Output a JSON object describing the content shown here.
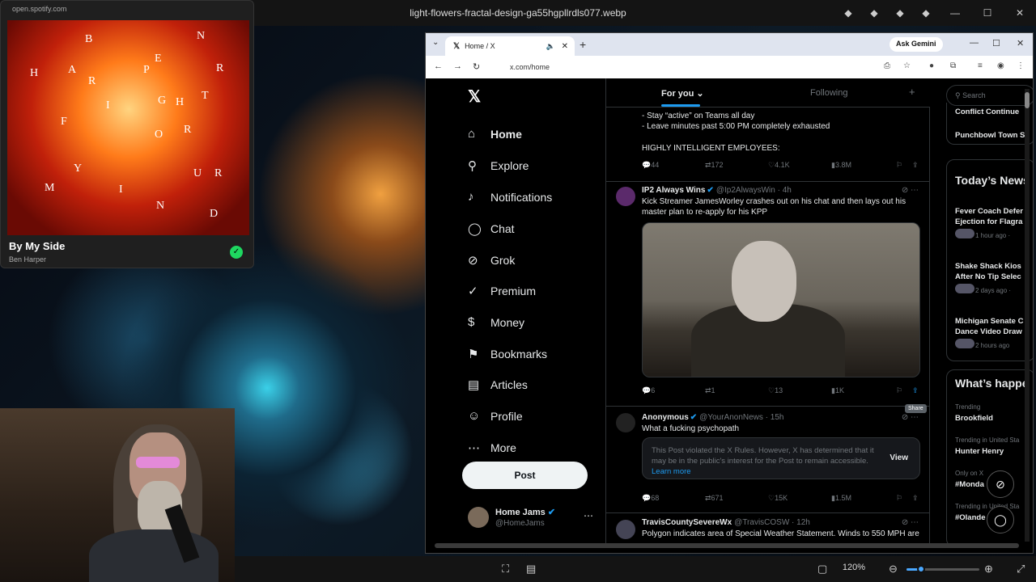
{
  "viewer": {
    "title": "light-flowers-fractal-design-ga55hgpllrdls077.webp",
    "zoom": "120%",
    "zoom_level": 0.2
  },
  "spotify": {
    "url": "open.spotify.com",
    "song": "By My Side",
    "artist": "Ben Harper",
    "letters": [
      "B",
      "N",
      "E",
      "H",
      "A",
      "R",
      "P",
      "R",
      "T",
      "G",
      "H",
      "I",
      "F",
      "R",
      "O",
      "Y",
      "U",
      "R",
      "M",
      "I",
      "N",
      "D"
    ]
  },
  "browser": {
    "tab_title": "Home / X",
    "ask_gemini": "Ask Gemini",
    "url": "x.com/home"
  },
  "sidebar": {
    "items": [
      {
        "label": "Home",
        "icon": "⌂"
      },
      {
        "label": "Explore",
        "icon": "⚲"
      },
      {
        "label": "Notifications",
        "icon": "♪"
      },
      {
        "label": "Chat",
        "icon": "◯"
      },
      {
        "label": "Grok",
        "icon": "⊘"
      },
      {
        "label": "Premium",
        "icon": "✓"
      },
      {
        "label": "Money",
        "icon": "$"
      },
      {
        "label": "Bookmarks",
        "icon": "⚑"
      },
      {
        "label": "Articles",
        "icon": "▤"
      },
      {
        "label": "Profile",
        "icon": "☺"
      },
      {
        "label": "More",
        "icon": "⋯"
      }
    ],
    "post_button": "Post",
    "account_name": "Home Jams",
    "account_handle": "@HomeJams"
  },
  "feed": {
    "tabs": [
      "For you",
      "Following"
    ],
    "post0": {
      "lines": [
        "- Stay “active” on Teams all day",
        "- Leave minutes past 5:00 PM completely exhausted",
        "HIGHLY INTELLIGENT EMPLOYEES:"
      ],
      "replies": "44",
      "reposts": "172",
      "likes": "4.1K",
      "views": "3.8M"
    },
    "post1": {
      "name": "IP2 Always Wins",
      "meta": "@Ip2AlwaysWin · 4h",
      "text1": "Kick Streamer JamesWorley crashes out on his chat and then lays out his",
      "text2": "master plan to re-apply for his KPP",
      "replies": "6",
      "reposts": "1",
      "likes": "13",
      "views": "1K"
    },
    "share_tooltip": "Share",
    "post2": {
      "name": "Anonymous",
      "meta": "@YourAnonNews · 15h",
      "text": "What a fucking psychopath",
      "notice1": "This Post violated the X Rules. However, X has determined",
      "notice2": "that it may be in the public's interest for the Post to remain",
      "notice3": "accessible.",
      "learn_more": "Learn more",
      "view": "View",
      "replies": "68",
      "reposts": "671",
      "likes": "15K",
      "views": "1.5M"
    },
    "post3": {
      "name": "TravisCountySevereWx",
      "meta": "@TravisCOSW · 12h",
      "text": "Polygon indicates area of Special Weather Statement. Winds to 550 MPH are"
    }
  },
  "right": {
    "search_placeholder": "Search",
    "partial1": "Conflict Continue",
    "partial2": "Punchbowl Town S",
    "news_header": "Today’s News",
    "news": [
      {
        "title1": "Fever Coach Defer",
        "title2": "Ejection for Flagra",
        "time": "1 hour ago ·"
      },
      {
        "title1": "Shake Shack Kios",
        "title2": "After No Tip Selec",
        "time": "2 days ago ·"
      },
      {
        "title1": "Michigan Senate C",
        "title2": "Dance Video Draw",
        "time": "2 hours ago"
      }
    ],
    "happening_header": "What’s happe",
    "trends": [
      {
        "label": "Trending",
        "name": "Brookfield"
      },
      {
        "label": "Trending in United Sta",
        "name": "Hunter Henry"
      },
      {
        "label": "Only on X",
        "name": "#Monda"
      },
      {
        "label": "Trending in United Sta",
        "name": "#Olande"
      }
    ]
  }
}
